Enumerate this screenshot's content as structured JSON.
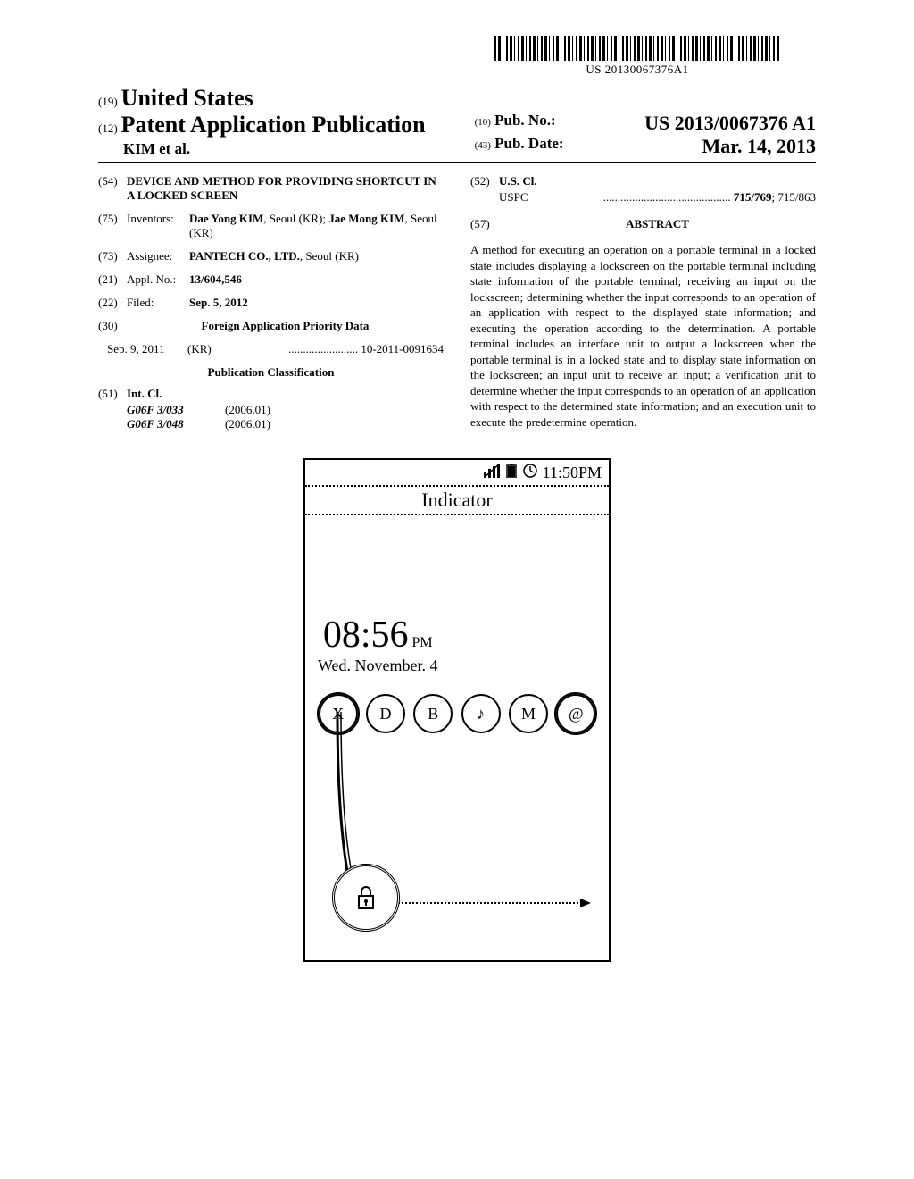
{
  "barcode_text": "US 20130067376A1",
  "header": {
    "code19": "(19)",
    "country": "United States",
    "code12": "(12)",
    "pub_type": "Patent Application Publication",
    "authors": "KIM et al.",
    "code10": "(10)",
    "pub_no_label": "Pub. No.:",
    "pub_no": "US 2013/0067376 A1",
    "code43": "(43)",
    "pub_date_label": "Pub. Date:",
    "pub_date": "Mar. 14, 2013"
  },
  "biblio": {
    "title_code": "(54)",
    "title": "DEVICE AND METHOD FOR PROVIDING SHORTCUT IN A LOCKED SCREEN",
    "inventors_code": "(75)",
    "inventors_label": "Inventors:",
    "inventors": "Dae Yong KIM, Seoul (KR); Jae Mong KIM, Seoul (KR)",
    "assignee_code": "(73)",
    "assignee_label": "Assignee:",
    "assignee": "PANTECH CO., LTD., Seoul (KR)",
    "applno_code": "(21)",
    "applno_label": "Appl. No.:",
    "applno": "13/604,546",
    "filed_code": "(22)",
    "filed_label": "Filed:",
    "filed": "Sep. 5, 2012",
    "foreign_code": "(30)",
    "foreign_heading": "Foreign Application Priority Data",
    "foreign_date": "Sep. 9, 2011",
    "foreign_country": "(KR)",
    "foreign_no": "10-2011-0091634",
    "pubclass_heading": "Publication Classification",
    "intcl_code": "(51)",
    "intcl_label": "Int. Cl.",
    "intcl_1": "G06F 3/033",
    "intcl_1_year": "(2006.01)",
    "intcl_2": "G06F 3/048",
    "intcl_2_year": "(2006.01)",
    "uscl_code": "(52)",
    "uscl_label": "U.S. Cl.",
    "uscl_prefix": "USPC",
    "uscl_values": "715/769; 715/863",
    "abstract_code": "(57)",
    "abstract_heading": "ABSTRACT",
    "abstract": "A method for executing an operation on a portable terminal in a locked state includes displaying a lockscreen on the portable terminal including state information of the portable terminal; receiving an input on the lockscreen; determining whether the input corresponds to an operation of an application with respect to the displayed state information; and executing the operation according to the determination. A portable terminal includes an interface unit to output a lockscreen when the portable terminal is in a locked state and to display state information on the lockscreen; an input unit to receive an input; a verification unit to determine whether the input corresponds to an operation of an application with respect to the determined state information; and an execution unit to execute the predetermine operation."
  },
  "figure": {
    "status_time": "11:50PM",
    "indicator_label": "Indicator",
    "clock_time": "08:56",
    "clock_ampm": "PM",
    "date": "Wed. November. 4",
    "shortcuts": [
      "X",
      "D",
      "B",
      "♪",
      "M",
      "@"
    ],
    "lock_icon": "🔒"
  }
}
